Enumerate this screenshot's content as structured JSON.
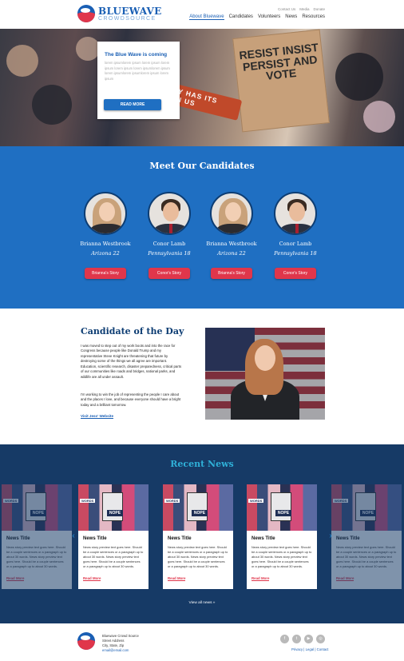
{
  "header": {
    "logo_line1": "BLUEWAVE",
    "logo_line2": "CROWDSOURCE",
    "utility": [
      "Contact Us",
      "Media",
      "Donate"
    ],
    "nav": [
      "About Bluewave",
      "Candidates",
      "Volunteers",
      "News",
      "Resources"
    ],
    "active_nav": "About Bluewave"
  },
  "hero": {
    "title": "The Blue Wave is coming",
    "body": "lorem ipsumlorem ipsum lorem ipsum lorem ipsum lorem ipsum lorem ipsumlorem ipsum lorem ipsumlorem ipsumlorem ipsum lorem ipsum",
    "button": "READ MORE",
    "sign_text": "RESIST INSIST PERSIST AND VOTE",
    "banner_text": "HISTORY HAS ITS EYES ON US"
  },
  "candidates": {
    "heading": "Meet Our Candidates",
    "items": [
      {
        "name": "Brianna Westbrook",
        "district": "Arizona 22",
        "button": "Brianna's Story"
      },
      {
        "name": "Conor Lamb",
        "district": "Pennsylvania 18",
        "button": "Conor's Story"
      },
      {
        "name": "Brianna Westbrook",
        "district": "Arizona 22",
        "button": "Brianna's Story"
      },
      {
        "name": "Conor Lamb",
        "district": "Pennsylvania 18",
        "button": "Conor's Story"
      }
    ]
  },
  "cotd": {
    "heading": "Candidate of the Day",
    "para1": "I was moved to step out of my work boots and into the race for Congress because people like Donald Trump and my representative Steve Knight are threatening that future by destroying some of the things we all agree are important. Education, scientific research, disaster preparedness, critical parts of our communities like roads and bridges, national parks, and wildlife are all under assault.",
    "para2": "I'm working to win the job of representing the people I care about and the places I love, and because everyone should have a bright today and a brilliant tomorrow.",
    "link": "Visit Jess' Website"
  },
  "news": {
    "heading": "Recent News",
    "cards": [
      {
        "title": "News Title",
        "body": "News story preview text goes here. Should be a couple sentences or a paragraph up to about 30 words. News story preview text goes here. Should be a couple sentences or a paragraph up to about 30 words.",
        "link": "Read More"
      },
      {
        "title": "News Title",
        "body": "News story preview text goes here. Should be a couple sentences or a paragraph up to about 30 words. News story preview text goes here. Should be a couple sentences or a paragraph up to about 30 words.",
        "link": "Read More"
      },
      {
        "title": "News Title",
        "body": "News story preview text goes here. Should be a couple sentences or a paragraph up to about 30 words. News story preview text goes here. Should be a couple sentences or a paragraph up to about 30 words.",
        "link": "Read More"
      },
      {
        "title": "News Title",
        "body": "News story preview text goes here. Should be a couple sentences or a paragraph up to about 30 words. News story preview text goes here. Should be a couple sentences or a paragraph up to about 30 words.",
        "link": "Read More"
      },
      {
        "title": "News Title",
        "body": "News story preview text goes here. Should be a couple sentences or a paragraph up to about 30 words. News story preview text goes here. Should be a couple sentences or a paragraph up to about 30 words.",
        "link": "Read More"
      }
    ],
    "image_words": "WORDS",
    "all_link": "View all news »"
  },
  "footer": {
    "org": "Bluewave Crowd Source",
    "street": "Street Address",
    "city": "City, State, Zip",
    "email": "email@email.com",
    "social": [
      "facebook-icon",
      "twitter-icon",
      "youtube-icon",
      "instagram-icon"
    ],
    "legal": [
      "Privacy",
      "Legal",
      "Contact"
    ]
  },
  "colors": {
    "primary": "#1f6fc2",
    "navy": "#163a66",
    "accent": "#e0364b",
    "news_heading": "#2fb0d8"
  }
}
